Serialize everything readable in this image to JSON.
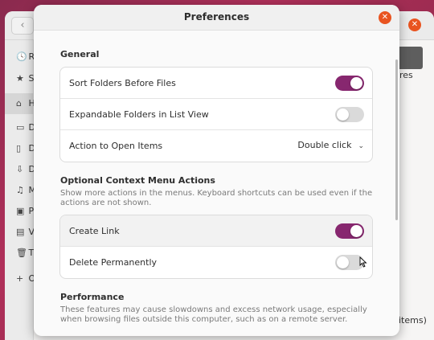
{
  "background_window": {
    "back_icon": "chevron-left-icon",
    "close_icon": "close-icon",
    "sidebar_items": [
      {
        "icon": "clock-icon",
        "glyph": "🕓",
        "label": "R"
      },
      {
        "icon": "star-icon",
        "glyph": "★",
        "label": "S"
      },
      {
        "icon": "home-icon",
        "glyph": "⌂",
        "label": "H"
      },
      {
        "icon": "desktop-icon",
        "glyph": "▭",
        "label": "D"
      },
      {
        "icon": "document-icon",
        "glyph": "▯",
        "label": "D"
      },
      {
        "icon": "download-icon",
        "glyph": "⇩",
        "label": "D"
      },
      {
        "icon": "music-icon",
        "glyph": "♫",
        "label": "M"
      },
      {
        "icon": "pictures-icon",
        "glyph": "▣",
        "label": "P"
      },
      {
        "icon": "videos-icon",
        "glyph": "▤",
        "label": "V"
      },
      {
        "icon": "trash-icon",
        "glyph": "🗑",
        "label": "T"
      },
      {
        "icon": "plus-icon",
        "glyph": "+",
        "label": "O"
      }
    ],
    "folder_label": "res",
    "status_text": "items)"
  },
  "dialog": {
    "title": "Preferences",
    "general": {
      "title": "General",
      "rows": [
        {
          "label": "Sort Folders Before Files",
          "toggle": true
        },
        {
          "label": "Expandable Folders in List View",
          "toggle": false
        },
        {
          "label": "Action to Open Items",
          "value": "Double click"
        }
      ]
    },
    "context_menu": {
      "title": "Optional Context Menu Actions",
      "description": "Show more actions in the menus. Keyboard shortcuts can be used even if the actions are not shown.",
      "rows": [
        {
          "label": "Create Link",
          "toggle": true
        },
        {
          "label": "Delete Permanently",
          "toggle": false
        }
      ]
    },
    "performance": {
      "title": "Performance",
      "description": "These features may cause slowdowns and excess network usage, especially when browsing files outside this computer, such as on a remote server."
    }
  },
  "colors": {
    "accent": "#87276f",
    "close_button": "#e95420",
    "toggle_off": "#dadada"
  }
}
